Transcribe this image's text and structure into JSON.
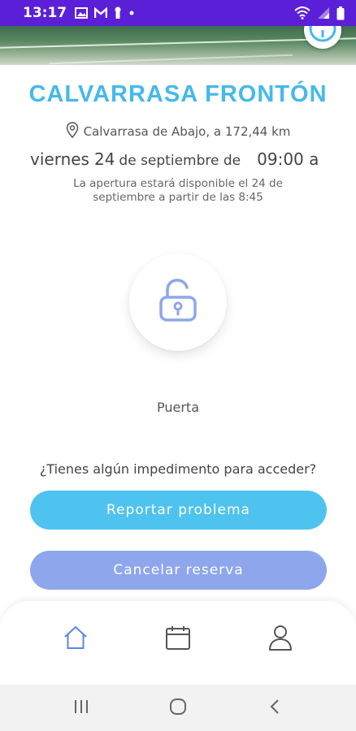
{
  "status_bar": {
    "time": "13:17",
    "left_icons": [
      "image-icon",
      "gmail-icon",
      "keyhole-icon",
      "dot-icon"
    ],
    "right_icons": [
      "wifi-icon",
      "signal-icon",
      "battery-icon"
    ],
    "background": "#5b1fd8"
  },
  "hero": {
    "info_icon": "info-icon"
  },
  "court": {
    "name": "CALVARRASA FRONTÓN",
    "location": "Calvarrasa de Abajo, a 172,44 km",
    "location_icon": "location-pin-icon",
    "accent_color": "#45b9ea"
  },
  "booking": {
    "weekday": "viernes",
    "day": "24",
    "month_text": "de septiembre de",
    "time_text": "09:00 a",
    "opening_note": "La apertura estará disponible el 24 de septiembre a partir de las 8:45"
  },
  "door": {
    "icon": "unlock-icon",
    "label": "Puerta"
  },
  "support": {
    "question": "¿Tienes algún impedimento para acceder?",
    "report_button": "Reportar problema",
    "cancel_button": "Cancelar reserva",
    "report_color": "#4ec3ef",
    "cancel_color": "#8ea6ec"
  },
  "bottom_nav": {
    "items": [
      {
        "name": "home",
        "icon": "home-icon",
        "active": true
      },
      {
        "name": "calendar",
        "icon": "calendar-icon",
        "active": false
      },
      {
        "name": "profile",
        "icon": "user-icon",
        "active": false
      }
    ]
  },
  "system_nav": {
    "items": [
      "recents-icon",
      "home-circle-icon",
      "back-icon"
    ]
  }
}
